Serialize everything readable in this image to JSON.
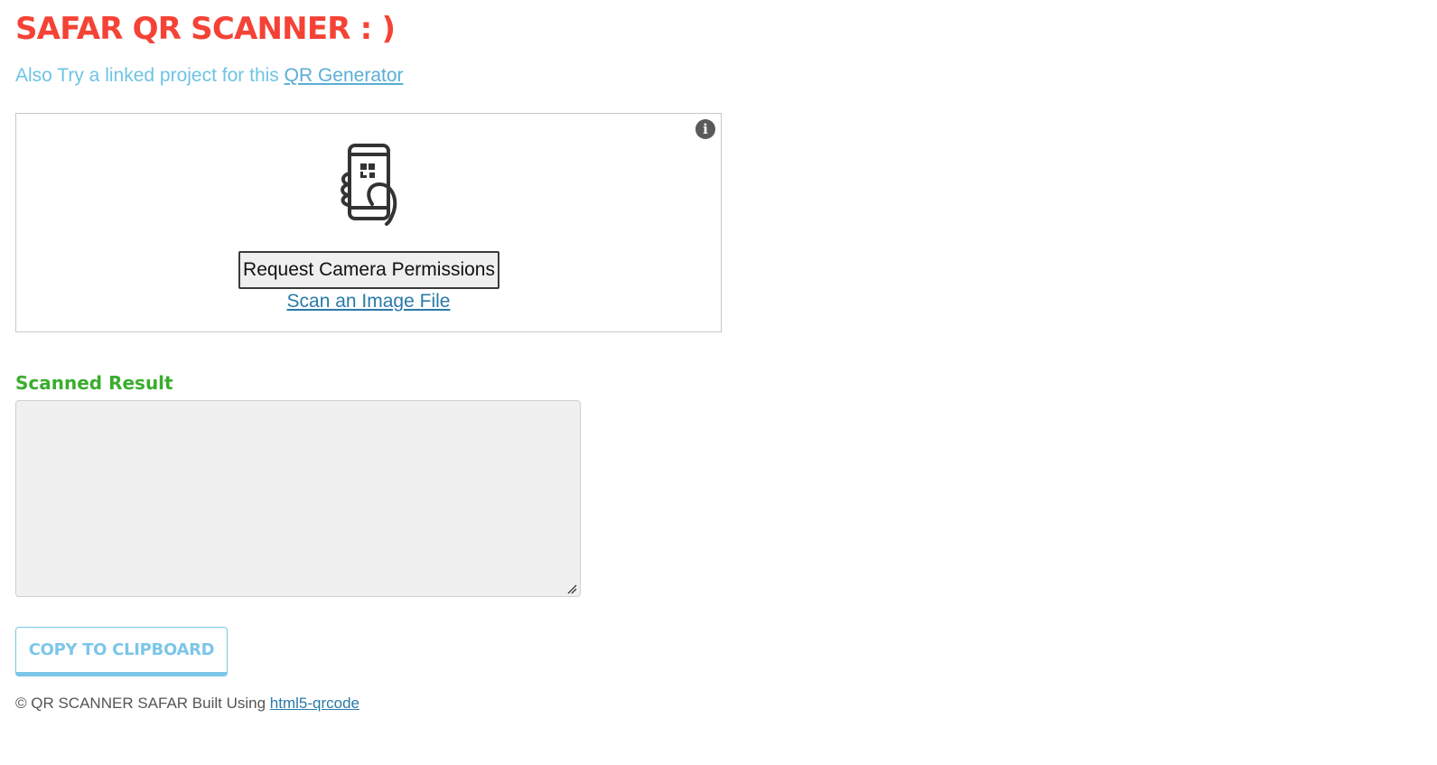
{
  "header": {
    "title": "SAFAR QR SCANNER : )",
    "subtitle_prefix": "Also Try a linked project for this ",
    "subtitle_link": "QR Generator"
  },
  "scanner": {
    "info_icon": "info-icon",
    "info_glyph": "i",
    "illustration_icon": "hand-holding-phone-qr-icon",
    "permission_button": "Request Camera Permissions",
    "scan_file_link": "Scan an Image File"
  },
  "result": {
    "label": "Scanned Result",
    "value": "",
    "resize_icon": "resize-grip-icon"
  },
  "actions": {
    "copy_button": "COPY TO CLIPBOARD"
  },
  "footer": {
    "text": "© QR SCANNER SAFAR Built Using ",
    "link": "html5-qrcode"
  },
  "colors": {
    "title": "#f44336",
    "subtitle": "#6ec3e6",
    "result_label": "#3aad2e",
    "copy_button": "#7cc6e8",
    "link": "#2a7aa8"
  }
}
